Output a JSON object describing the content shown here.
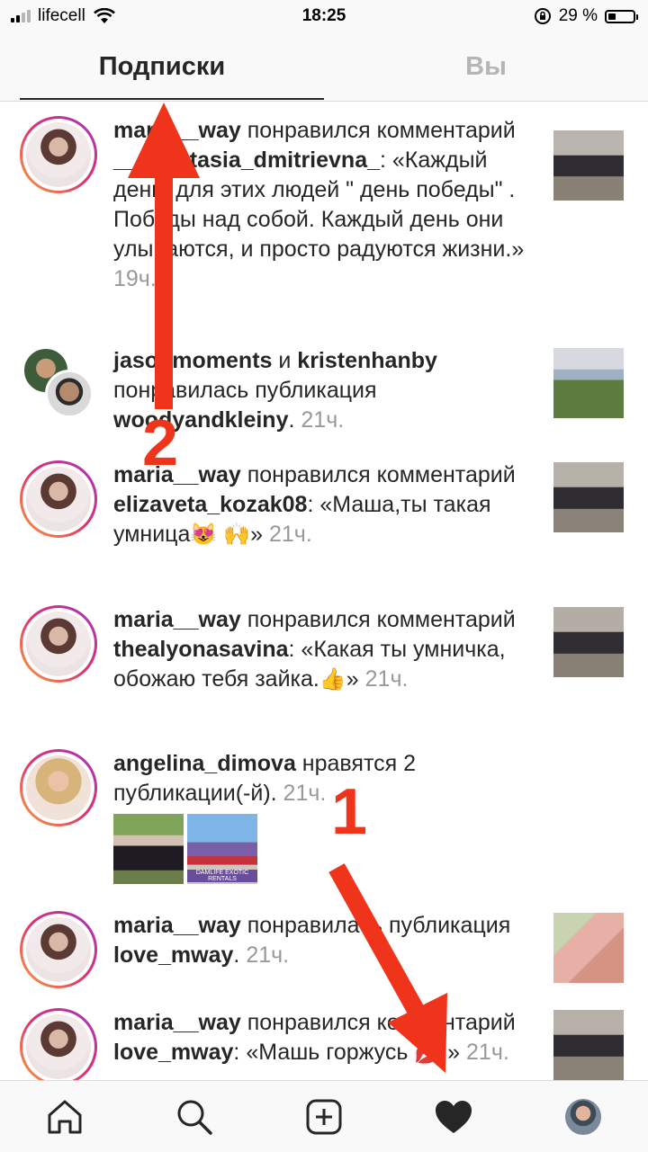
{
  "status_bar": {
    "carrier": "lifecell",
    "time": "18:25",
    "battery_pct": "29 %",
    "icons": [
      "signal-icon",
      "wifi-icon",
      "rotation-lock-icon",
      "battery-icon"
    ]
  },
  "tabs": [
    {
      "label": "Подписки",
      "active": true
    },
    {
      "label": "Вы",
      "active": false
    }
  ],
  "feed": [
    {
      "user": "maria__way",
      "action": " понравился комментарий ",
      "target": "__anastasia_dmitrievna_",
      "rest": ": «Каждый день, для этих людей \" день победы\" . Победы над собой. Каждый день они улыбаются, и просто радуются жизни.» ",
      "time": "19ч."
    },
    {
      "user": "jasonmoments",
      "joiner": " и ",
      "user2": "kristenhanby",
      "action": " понравилась публикация ",
      "target": "woodyandkleiny",
      "rest": ". ",
      "time": "21ч."
    },
    {
      "user": "maria__way",
      "action": " понравился комментарий ",
      "target": "elizaveta_kozak08",
      "rest": ": «Маша,ты такая умница",
      "emoji1": "😻",
      "emoji2": "🙌",
      "rest2": "» ",
      "time": "21ч."
    },
    {
      "user": "maria__way",
      "action": " понравился комментарий ",
      "target": "thealyonasavina",
      "rest": ": «Какая ты умничка, обожаю тебя зайка.",
      "emoji1": "👍",
      "rest2": "» ",
      "time": "21ч."
    },
    {
      "user": "angelina_dimova",
      "action": " нравятся 2 публикации(-й). ",
      "time": "21ч.",
      "thumb_caption": "DAMLIFE EXOTIC RENTALS"
    },
    {
      "user": "maria__way",
      "action": " понравилась публикация ",
      "target": "love_mway",
      "rest": ". ",
      "time": "21ч."
    },
    {
      "user": "maria__way",
      "action": " понравился комментарий ",
      "target": "love_mway",
      "rest": ": «Машь горжусь ",
      "emoji1": "💋",
      "rest2": " » ",
      "time": "21ч."
    }
  ],
  "annotations": {
    "arrow_1_label": "1",
    "arrow_2_label": "2",
    "color": "#f0341b"
  },
  "bottom_nav": [
    "home-icon",
    "search-icon",
    "add-post-icon",
    "activity-heart-icon",
    "profile-avatar"
  ],
  "colors": {
    "timestamp": "#999999",
    "tab_inactive": "#b5b5b5",
    "avatar_ring": "#e1306c"
  }
}
